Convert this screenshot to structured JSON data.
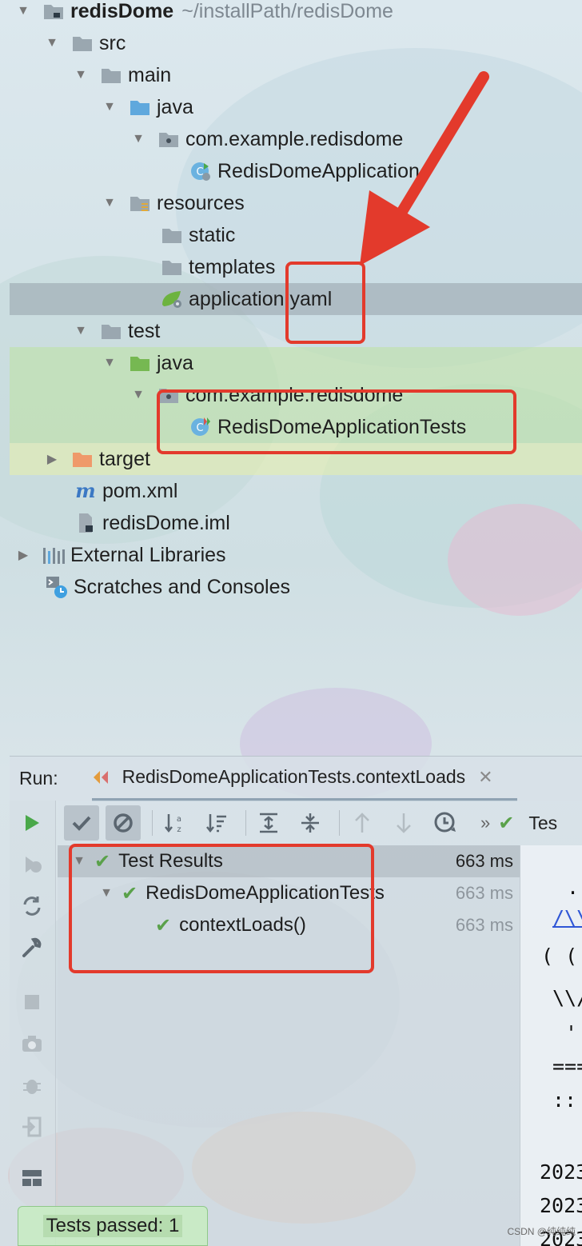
{
  "tree": {
    "root": {
      "label": "redisDome",
      "path": "~/installPath/redisDome"
    },
    "src": "src",
    "main": "main",
    "main_java": "java",
    "main_package": "com.example.redisdome",
    "main_class": "RedisDomeApplication",
    "resources": "resources",
    "static": "static",
    "templates": "templates",
    "config_file": "application.yaml",
    "test": "test",
    "test_java": "java",
    "test_package": "com.example.redisdome",
    "test_class": "RedisDomeApplicationTests",
    "target": "target",
    "pom": "pom.xml",
    "iml": "redisDome.iml",
    "external_libraries": "External Libraries",
    "scratches": "Scratches and Consoles"
  },
  "run": {
    "title": "Run:",
    "tab_label": "RedisDomeApplicationTests.contextLoads",
    "toolbar_more": "»",
    "toolbar_tail": "Tes"
  },
  "results": [
    {
      "label": "Test Results",
      "time": "663 ms"
    },
    {
      "label": "RedisDomeApplicationTests",
      "time": "663 ms"
    },
    {
      "label": "contextLoads()",
      "time": "663 ms"
    }
  ],
  "console": {
    "lines": [
      ".",
      "/\\\\",
      "( (",
      "\\\\/",
      "'",
      "===",
      "::",
      "2023",
      "2023",
      "2023"
    ]
  },
  "status": {
    "text": "Tests passed: 1"
  },
  "watermark": "CSDN @纯纯纯"
}
